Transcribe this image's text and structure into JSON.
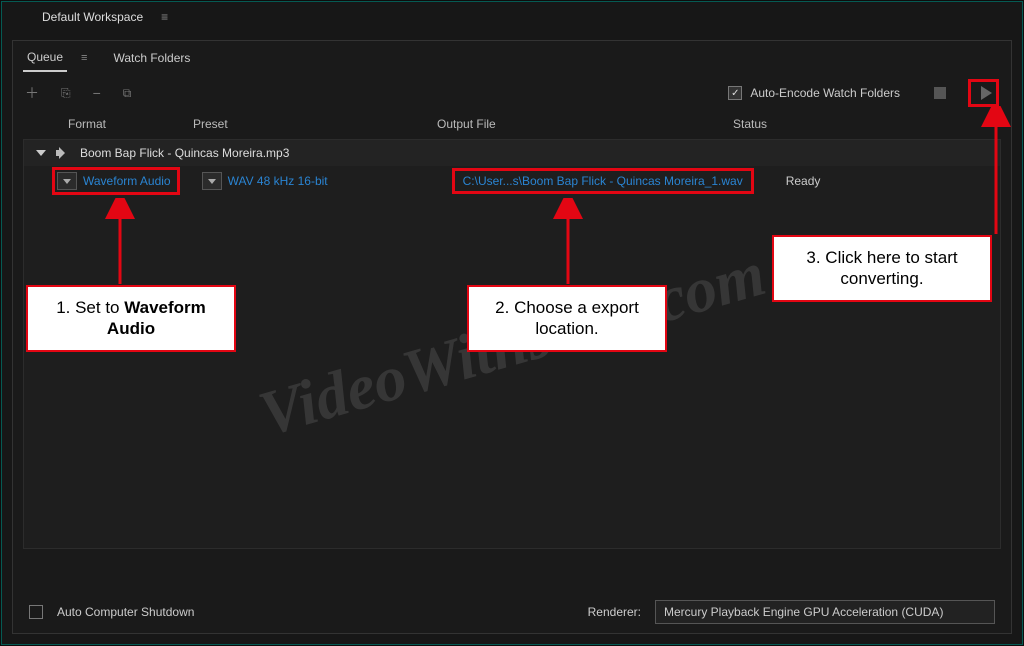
{
  "workspace": {
    "name": "Default Workspace"
  },
  "tabs": {
    "queue": "Queue",
    "watch_folders": "Watch Folders"
  },
  "toolbar": {
    "auto_encode_label": "Auto-Encode Watch Folders"
  },
  "columns": {
    "format": "Format",
    "preset": "Preset",
    "output_file": "Output File",
    "status": "Status"
  },
  "queue": {
    "source_name": "Boom Bap Flick - Quincas Moreira.mp3",
    "row": {
      "format": "Waveform Audio",
      "preset": "WAV 48 kHz 16-bit",
      "output_file": "C:\\User...s\\Boom Bap Flick - Quincas Moreira_1.wav",
      "status": "Ready"
    }
  },
  "callouts": {
    "c1_prefix": "1. Set to ",
    "c1_bold": "Waveform Audio",
    "c2": "2. Choose a export location.",
    "c3": "3. Click here to start converting."
  },
  "watermark": "VideoWithJens.com",
  "footer": {
    "shutdown": "Auto Computer Shutdown",
    "renderer_label": "Renderer:",
    "renderer_value": "Mercury Playback Engine GPU Acceleration (CUDA)"
  }
}
